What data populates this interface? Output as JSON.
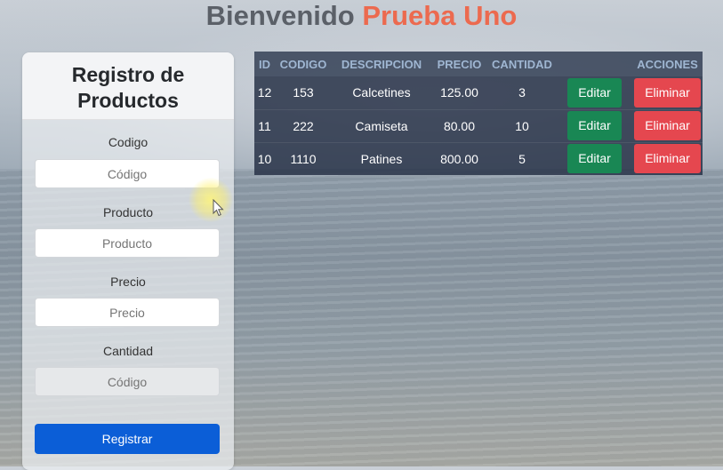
{
  "header": {
    "title_prefix": "Bienvenido",
    "title_name": "Prueba Uno"
  },
  "form": {
    "title": "Registro de Productos",
    "fields": [
      {
        "label": "Codigo",
        "placeholder": "Código"
      },
      {
        "label": "Producto",
        "placeholder": "Producto"
      },
      {
        "label": "Precio",
        "placeholder": "Precio"
      },
      {
        "label": "Cantidad",
        "placeholder": "Código"
      }
    ],
    "submit_label": "Registrar"
  },
  "table": {
    "columns": [
      "ID",
      "CODIGO",
      "DESCRIPCION",
      "PRECIO",
      "CANTIDAD",
      "",
      "ACCIONES"
    ],
    "rows": [
      {
        "id": "12",
        "codigo": "153",
        "descripcion": "Calcetines",
        "precio": "125.00",
        "cantidad": "3"
      },
      {
        "id": "11",
        "codigo": "222",
        "descripcion": "Camiseta",
        "precio": "80.00",
        "cantidad": "10"
      },
      {
        "id": "10",
        "codigo": "1110",
        "descripcion": "Patines",
        "precio": "800.00",
        "cantidad": "5"
      }
    ],
    "edit_label": "Editar",
    "delete_label": "Eliminar"
  },
  "colors": {
    "title_grey": "#5b6068",
    "title_accent": "#ec6a4f",
    "register_button": "#0b5ed7",
    "edit_button": "#198754",
    "delete_button": "#e5474f",
    "table_bg": "#283248"
  }
}
